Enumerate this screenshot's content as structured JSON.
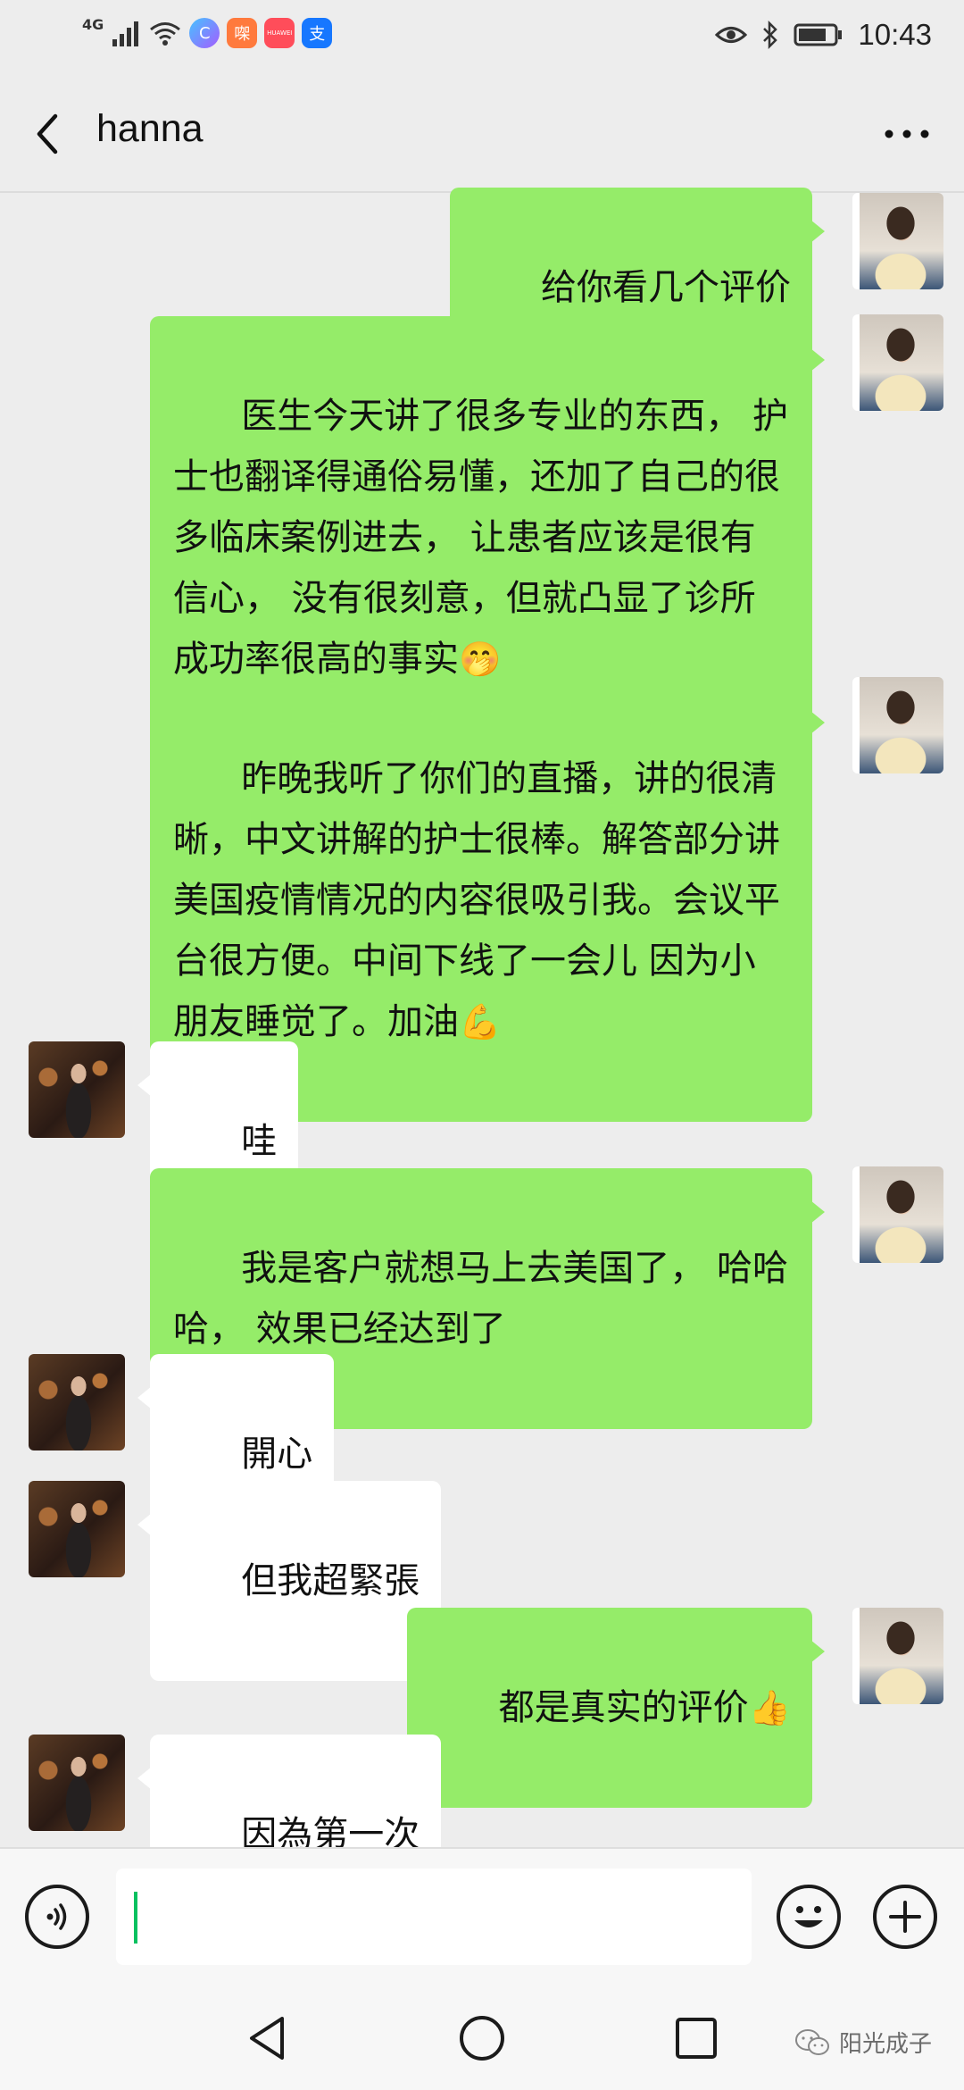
{
  "status_bar": {
    "network": "4G",
    "time": "10:43",
    "apps": [
      {
        "icon": "c-app-icon",
        "glyph": "C",
        "color": "#7a6cf0"
      },
      {
        "icon": "shopping-app-icon",
        "glyph": "㗎",
        "color": "#ff6b3d"
      },
      {
        "icon": "huawei-mall-icon",
        "glyph": "HUAWEI",
        "color": "#ff4d5a"
      },
      {
        "icon": "alipay-icon",
        "glyph": "支",
        "color": "#1677ff"
      }
    ]
  },
  "header": {
    "title": "hanna"
  },
  "messages": [
    {
      "from": "me",
      "text": "给你看几个评价"
    },
    {
      "from": "me",
      "text": "医生今天讲了很多专业的东西， 护士也翻译得通俗易懂，还加了自己的很多临床案例进去， 让患者应该是很有信心， 没有很刻意，但就凸显了诊所成功率很高的事实",
      "emoji": "🤭"
    },
    {
      "from": "me",
      "text": "昨晚我听了你们的直播，讲的很清晰，中文讲解的护士很棒。解答部分讲美国疫情情况的内容很吸引我。会议平台很方便。中间下线了一会儿 因为小朋友睡觉了。加油",
      "emoji": "💪"
    },
    {
      "from": "them",
      "text": "哇"
    },
    {
      "from": "me",
      "text": "我是客户就想马上去美国了， 哈哈哈， 效果已经达到了"
    },
    {
      "from": "them",
      "text": "開心"
    },
    {
      "from": "them",
      "text": "但我超緊張"
    },
    {
      "from": "me",
      "text": "都是真实的评价",
      "emoji": "👍"
    },
    {
      "from": "them",
      "text": "因為第一次"
    }
  ],
  "input": {
    "value": ""
  },
  "watermark": {
    "text": "阳光成子"
  }
}
